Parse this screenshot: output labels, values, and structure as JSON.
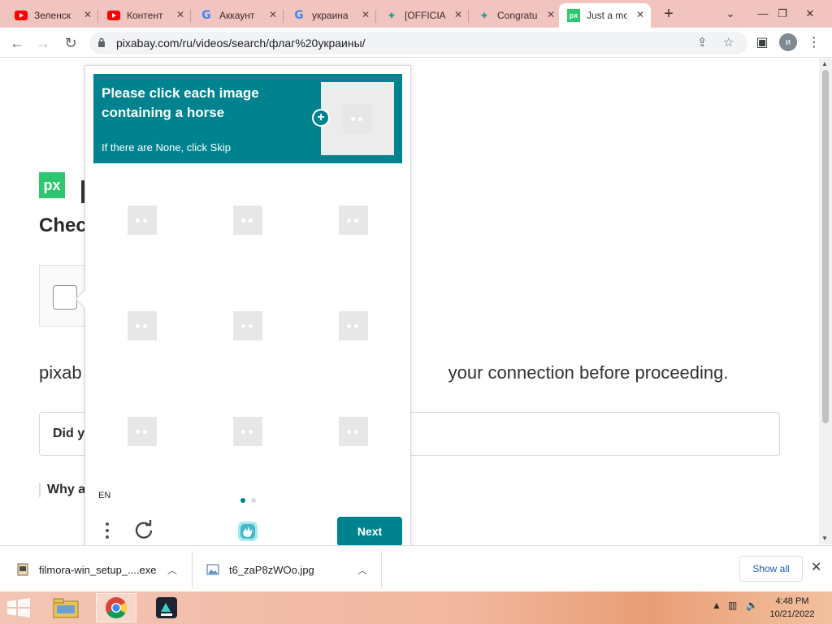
{
  "browser": {
    "tabs": [
      {
        "title": "Зеленск",
        "favicon": "youtube-icon"
      },
      {
        "title": "Контент",
        "favicon": "youtube-icon"
      },
      {
        "title": "Аккаунт",
        "favicon": "google-icon"
      },
      {
        "title": "украина",
        "favicon": "google-icon"
      },
      {
        "title": "[OFFICIA",
        "favicon": "star-icon"
      },
      {
        "title": "Congratu",
        "favicon": "star-icon"
      },
      {
        "title": "Just a mo",
        "favicon": "pixabay-icon",
        "active": true
      }
    ],
    "url": "pixabay.com/ru/videos/search/флаг%20украины/",
    "profile_initial": "и"
  },
  "page": {
    "logo_text": "px",
    "heading": "Check",
    "description": "pixab",
    "description_tail": "your connection before proceeding.",
    "did_you": "Did yo",
    "why": "Why a"
  },
  "captcha": {
    "title": "Please click each image containing a horse",
    "subtitle": "If there are None, click Skip",
    "language": "EN",
    "next_label": "Next",
    "accent_color": "#00838f",
    "grid_cells": 9,
    "current_page": 1,
    "total_pages": 2
  },
  "downloads": {
    "items": [
      {
        "name": "filmora-win_setup_....exe"
      },
      {
        "name": "t6_zaP8zWOo.jpg"
      }
    ],
    "show_all_label": "Show all"
  },
  "taskbar": {
    "time": "4:48 PM",
    "date": "10/21/2022"
  }
}
